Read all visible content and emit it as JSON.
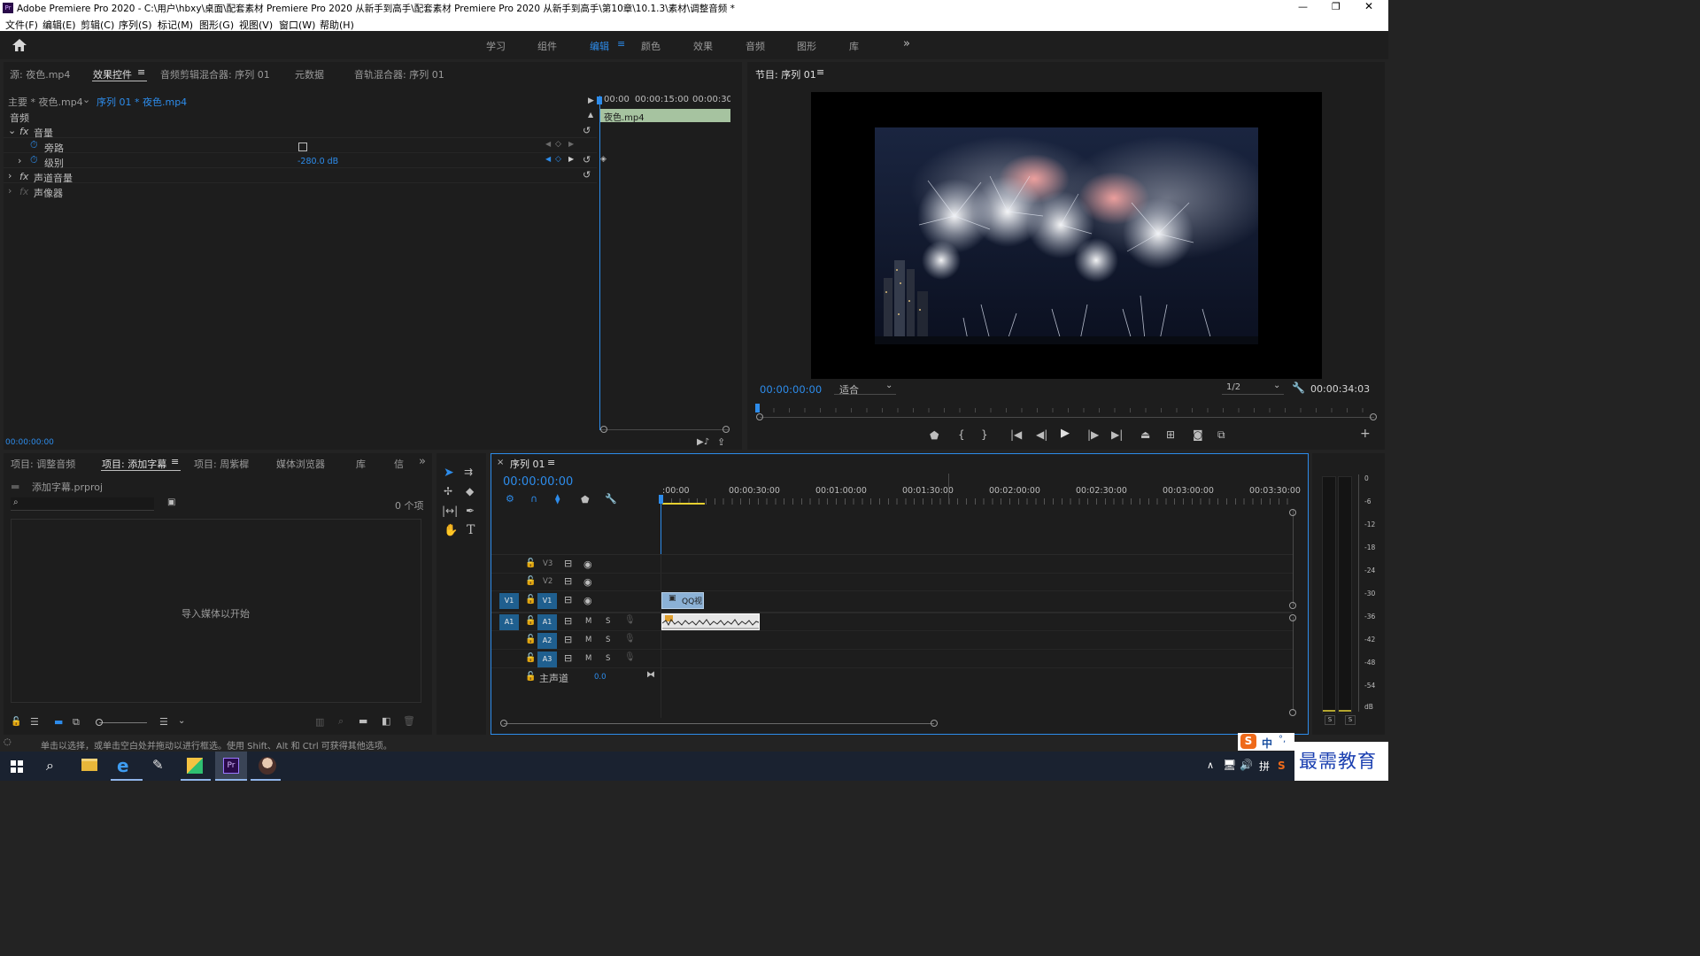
{
  "window": {
    "app_icon": "Pr",
    "title": "Adobe Premiere Pro 2020 - C:\\用户\\hbxy\\桌面\\配套素材 Premiere Pro 2020 从新手到高手\\配套素材 Premiere Pro 2020 从新手到高手\\第10章\\10.1.3\\素材\\调整音频 *",
    "controls": [
      "—",
      "❐",
      "✕"
    ]
  },
  "menu": [
    "文件(F)",
    "编辑(E)",
    "剪辑(C)",
    "序列(S)",
    "标记(M)",
    "图形(G)",
    "视图(V)",
    "窗口(W)",
    "帮助(H)"
  ],
  "workspaces": {
    "items": [
      "学习",
      "组件",
      "编辑",
      "颜色",
      "效果",
      "音频",
      "图形",
      "库"
    ],
    "active": "编辑",
    "overflow": "»"
  },
  "source_panel": {
    "tabs": [
      "源: 夜色.mp4",
      "效果控件",
      "音频剪辑混合器: 序列 01",
      "元数据",
      "音轨混合器: 序列 01"
    ],
    "active_tab": "效果控件",
    "clip_master": "主要 * 夜色.mp4",
    "clip_seq": "序列 01 * 夜色.mp4",
    "timecodes": [
      "00:00",
      "00:00:15:00",
      "00:00:30:0"
    ],
    "clip_name": "夜色.mp4",
    "section": "音频",
    "effects": [
      {
        "name": "音量",
        "fx": "fx",
        "expanded": true
      },
      {
        "name": "旁路",
        "indent": 2,
        "checkbox": true
      },
      {
        "name": "级别",
        "indent": 2,
        "value": "-280.0 dB"
      },
      {
        "name": "声道音量",
        "fx": "fx"
      },
      {
        "name": "声像器",
        "fx": "fx",
        "dim": true
      }
    ],
    "timecode": "00:00:00:00"
  },
  "program_monitor": {
    "title": "节目: 序列 01",
    "timecode": "00:00:00:00",
    "fit": "适合",
    "resolution": "1/2",
    "duration": "00:00:34:03",
    "transport": [
      "marker-icon",
      "in-point-icon",
      "out-point-icon",
      "go-to-in-icon",
      "step-back-icon",
      "play-icon",
      "step-forward-icon",
      "go-to-out-icon",
      "lift-icon",
      "extract-icon",
      "export-frame-icon",
      "compare-icon"
    ],
    "add": "+"
  },
  "project_panel": {
    "tabs": [
      "项目: 调整音频",
      "项目: 添加字幕",
      "项目: 周紫樨",
      "媒体浏览器",
      "库",
      "信"
    ],
    "active_tab": "项目: 添加字幕",
    "file": "添加字幕.prproj",
    "count": "0 个项",
    "empty_text": "导入媒体以开始",
    "overflow": "»"
  },
  "timeline": {
    "title": "序列 01",
    "close": "×",
    "timecode": "00:00:00:00",
    "ruler": [
      ":00:00",
      "00:00:30:00",
      "00:01:00:00",
      "00:01:30:00",
      "00:02:00:00",
      "00:02:30:00",
      "00:03:00:00",
      "00:03:30:00"
    ],
    "video_tracks": [
      "V3",
      "V2",
      "V1"
    ],
    "audio_tracks": [
      "A1",
      "A2",
      "A3"
    ],
    "src_v": "V1",
    "src_a": "A1",
    "master_label": "主声道",
    "master_value": "0.0",
    "video_clip": "QQ视",
    "m_label": "M",
    "s_label": "S"
  },
  "meter": {
    "scale": [
      "0",
      "-6",
      "-12",
      "-18",
      "-24",
      "-30",
      "-36",
      "-42",
      "-48",
      "-54",
      "dB"
    ],
    "solo": [
      "S",
      "S"
    ]
  },
  "status_bar": {
    "text": "单击以选择，或单击空白处并拖动以进行框选。使用 Shift、Alt 和 Ctrl 可获得其他选项。"
  },
  "ime": {
    "label": "中",
    "punct": "°,"
  },
  "watermark": "最需教育",
  "colors": {
    "accent": "#2d8ceb",
    "panel": "#1d1d1d",
    "background": "#232323",
    "clip_video": "#8bb1d6",
    "clip_audio": "#e6e6e6",
    "clip_fx": "#a6c3a0"
  }
}
